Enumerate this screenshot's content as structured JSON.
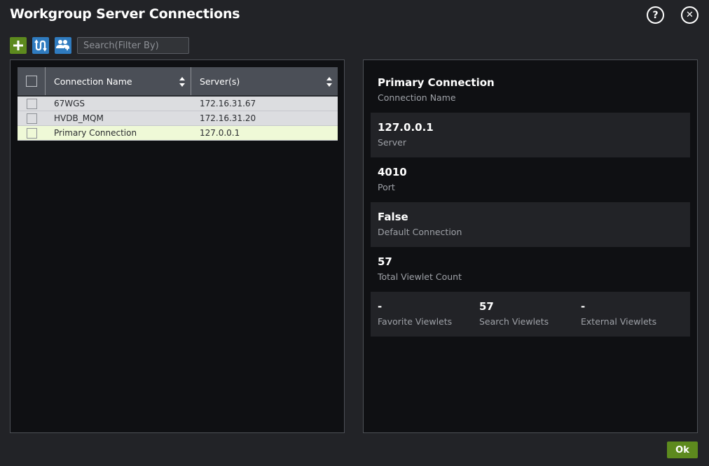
{
  "window": {
    "title": "Workgroup Server Connections",
    "help_label": "?",
    "close_label": "✕"
  },
  "toolbar": {
    "add_icon": "plus-icon",
    "connect_icon": "connection-icon",
    "users_icon": "users-add-icon",
    "search_placeholder": "Search(Filter By)",
    "search_value": ""
  },
  "table": {
    "columns": [
      "Connection Name",
      "Server(s)"
    ],
    "rows": [
      {
        "name": "67WGS",
        "server": "172.16.31.67",
        "selected": false
      },
      {
        "name": "HVDB_MQM",
        "server": "172.16.31.20",
        "selected": false
      },
      {
        "name": "Primary Connection",
        "server": "127.0.0.1",
        "selected": true
      }
    ]
  },
  "details": {
    "connection_name": {
      "value": "Primary Connection",
      "label": "Connection Name"
    },
    "server": {
      "value": "127.0.0.1",
      "label": "Server"
    },
    "port": {
      "value": "4010",
      "label": "Port"
    },
    "default_connection": {
      "value": "False",
      "label": "Default Connection"
    },
    "total_viewlet_count": {
      "value": "57",
      "label": "Total Viewlet Count"
    },
    "favorite_viewlets": {
      "value": "-",
      "label": "Favorite Viewlets"
    },
    "search_viewlets": {
      "value": "57",
      "label": "Search Viewlets"
    },
    "external_viewlets": {
      "value": "-",
      "label": "External Viewlets"
    }
  },
  "footer": {
    "ok_label": "Ok"
  },
  "colors": {
    "background": "#222327",
    "panel": "#0f1013",
    "accent_green": "#5d8a1e",
    "accent_blue": "#2f7bbf",
    "selected_row": "#eff9d7"
  }
}
